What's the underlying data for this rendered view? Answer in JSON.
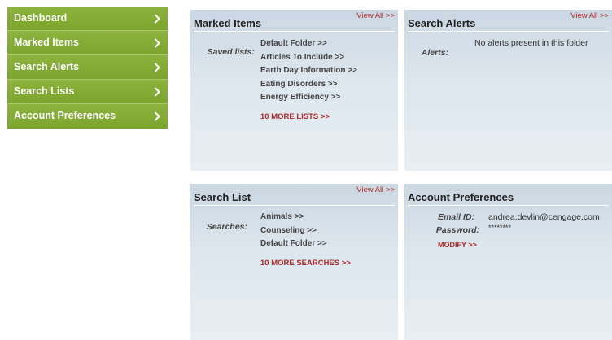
{
  "sidebar": {
    "items": [
      {
        "label": "Dashboard"
      },
      {
        "label": "Marked Items"
      },
      {
        "label": "Search Alerts"
      },
      {
        "label": "Search Lists"
      },
      {
        "label": "Account Preferences"
      }
    ]
  },
  "marked_items": {
    "title": "Marked Items",
    "view_all": "View All >>",
    "saved_lists_label": "Saved lists:",
    "lists": [
      "Default Folder >>",
      "Articles To Include >>",
      "Earth Day Information >>",
      "Eating Disorders >>",
      "Energy Efficiency >>"
    ],
    "more": "10 MORE LISTS >>"
  },
  "search_alerts": {
    "title": "Search Alerts",
    "view_all": "View All >>",
    "alerts_label": "Alerts:",
    "empty_message": "No alerts present in this folder"
  },
  "search_list": {
    "title": "Search List",
    "view_all": "View All >>",
    "searches_label": "Searches:",
    "searches": [
      "Animals >>",
      "Counseling >>",
      "Default Folder >>"
    ],
    "more": "10 MORE SEARCHES >>"
  },
  "account_preferences": {
    "title": "Account Preferences",
    "email_label": "Email ID:",
    "email_value": "andrea.devlin@cengage.com",
    "password_label": "Password:",
    "password_value": "********",
    "modify": "MODIFY >>"
  },
  "colors": {
    "sidebar_green": "#7aa52c",
    "link_red": "#b22a2a",
    "panel_blue": "#c9d7e2"
  }
}
